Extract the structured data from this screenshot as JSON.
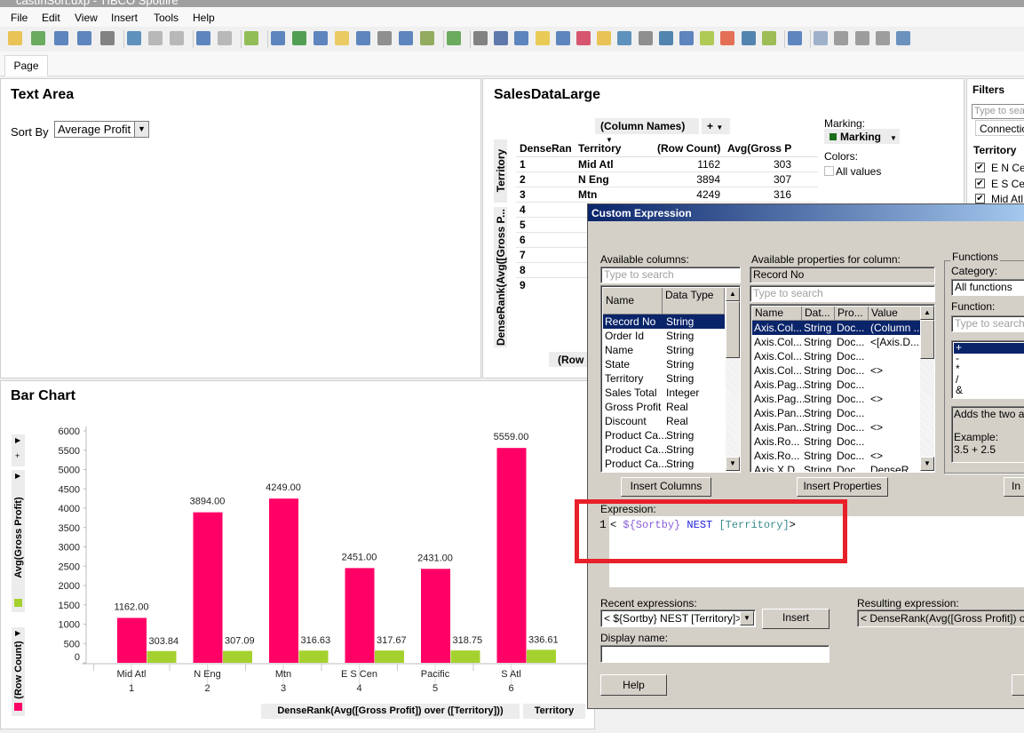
{
  "window": {
    "title": "castInSort.dxp - TIBCO Spotfire"
  },
  "menu": [
    "File",
    "Edit",
    "View",
    "Insert",
    "Tools",
    "Help"
  ],
  "toolbar": {
    "icons": [
      "open-folder-icon",
      "add-data-table-icon",
      "reload-icon",
      "save-icon",
      "print-icon",
      "export-icon",
      "copy-icon",
      "paste-icon",
      "undo-icon",
      "redo-icon",
      "reset-icon",
      "filter-icon",
      "details-on-demand-icon",
      "visualization-properties-icon",
      "tags-icon",
      "bookmark-icon",
      "collaboration-icon",
      "lists-icon",
      "line-similarity-icon",
      "new-page-icon",
      "table-icon",
      "cross-table-icon",
      "graphical-table-icon",
      "bar-chart-icon",
      "line-chart-icon",
      "combination-chart-icon",
      "pie-chart-icon",
      "scatter-plot-icon",
      "3d-scatter-icon",
      "map-chart-icon",
      "treemap-icon",
      "heat-map-icon",
      "parallel-coordinates-icon",
      "summary-table-icon",
      "box-plot-icon",
      "text-area-icon",
      "settings-gear-icon",
      "layout-grid-icon",
      "layout-columns-icon",
      "layout-rows-icon",
      "maximize-icon"
    ]
  },
  "tabs": [
    {
      "label": "Page",
      "active": true
    }
  ],
  "text_area": {
    "title": "Text Area",
    "sort_label": "Sort By",
    "sort_value": "Average Profit"
  },
  "table": {
    "title": "SalesDataLarge",
    "column_names_label": "(Column Names)",
    "plus_label": "+",
    "axis_territory": "Territory",
    "axis_dense": "DenseRank(Avg([Gross P...",
    "row_count_axis": "(Row C",
    "headers": [
      "DenseRank...",
      "Territory",
      "(Row Count)",
      "Avg(Gross P"
    ],
    "rows": [
      [
        "1",
        "Mid Atl",
        "1162",
        "303"
      ],
      [
        "2",
        "N Eng",
        "3894",
        "307"
      ],
      [
        "3",
        "Mtn",
        "4249",
        "316"
      ],
      [
        "4",
        "",
        "",
        ""
      ],
      [
        "5",
        "",
        "",
        ""
      ],
      [
        "6",
        "",
        "",
        ""
      ],
      [
        "7",
        "",
        "",
        ""
      ],
      [
        "8",
        "",
        "",
        ""
      ],
      [
        "9",
        "",
        "",
        ""
      ]
    ],
    "marking_label": "Marking:",
    "marking_value": "Marking",
    "marking_color": "#1a6e1a",
    "colors_label": "Colors:",
    "all_values_label": "All values"
  },
  "filters": {
    "title": "Filters",
    "search_placeholder": "Type to search",
    "connection": "Connection",
    "group": "Territory",
    "items": [
      {
        "label": "E N Cen",
        "checked": true
      },
      {
        "label": "E S Cen",
        "checked": true
      },
      {
        "label": "Mid Atl",
        "checked": true
      }
    ]
  },
  "bar_chart": {
    "title": "Bar Chart",
    "legend_row_count": "(Row Count)",
    "legend_avg": "Avg(Gross Profit)",
    "x_axis_title": "DenseRank(Avg([Gross Profit]) over ([Territory]))",
    "x_axis_title2": "Territory"
  },
  "chart_data": {
    "type": "bar",
    "title": "Bar Chart",
    "categories": [
      "Mid Atl",
      "N Eng",
      "Mtn",
      "E S Cen",
      "Pacific",
      "S Atl"
    ],
    "category_ranks": [
      "1",
      "2",
      "3",
      "4",
      "5",
      "6"
    ],
    "series": [
      {
        "name": "(Row Count)",
        "color": "#ff0066",
        "values": [
          1162,
          3894,
          4249,
          2451,
          2431,
          5559
        ],
        "labels": [
          "1162.00",
          "3894.00",
          "4249.00",
          "2451.00",
          "2431.00",
          "5559.00"
        ]
      },
      {
        "name": "Avg(Gross Profit)",
        "color": "#a5d12f",
        "values": [
          303.84,
          307.09,
          316.63,
          317.67,
          318.75,
          336.61
        ],
        "labels": [
          "303.84",
          "307.09",
          "316.63",
          "317.67",
          "318.75",
          "336.61"
        ]
      }
    ],
    "yticks": [
      "0",
      "500",
      "1000",
      "1500",
      "2000",
      "2500",
      "3000",
      "3500",
      "4000",
      "4500",
      "5000",
      "5500",
      "6000"
    ],
    "ylim": [
      0,
      6000
    ],
    "xlabel": "DenseRank(Avg([Gross Profit]) over ([Territory]))",
    "ylabel": "Avg(Gross Profit) / (Row Count)",
    "grid": false
  },
  "dialog": {
    "title": "Custom Expression",
    "available_columns_label": "Available columns:",
    "search_placeholder": "Type to search",
    "columns_headers": [
      "Name",
      "Data Type"
    ],
    "columns": [
      [
        "Record No",
        "String"
      ],
      [
        "Order Id",
        "String"
      ],
      [
        "Name",
        "String"
      ],
      [
        "State",
        "String"
      ],
      [
        "Territory",
        "String"
      ],
      [
        "Sales Total",
        "Integer"
      ],
      [
        "Gross Profit",
        "Real"
      ],
      [
        "Discount",
        "Real"
      ],
      [
        "Product Ca...",
        "String"
      ],
      [
        "Product Ca...",
        "String"
      ],
      [
        "Product Ca...",
        "String"
      ]
    ],
    "properties_label": "Available properties for column:",
    "selected_column": "Record No",
    "properties_headers": [
      "Name",
      "Dat...",
      "Pro...",
      "Value"
    ],
    "properties": [
      [
        "Axis.Col...",
        "String",
        "Doc...",
        "(Column ..."
      ],
      [
        "Axis.Col...",
        "String",
        "Doc...",
        "<[Axis.D..."
      ],
      [
        "Axis.Col...",
        "String",
        "Doc...",
        ""
      ],
      [
        "Axis.Col...",
        "String",
        "Doc...",
        "<>"
      ],
      [
        "Axis.Pag...",
        "String",
        "Doc...",
        ""
      ],
      [
        "Axis.Pag...",
        "String",
        "Doc...",
        "<>"
      ],
      [
        "Axis.Pan...",
        "String",
        "Doc...",
        ""
      ],
      [
        "Axis.Pan...",
        "String",
        "Doc...",
        "<>"
      ],
      [
        "Axis.Ro...",
        "String",
        "Doc...",
        ""
      ],
      [
        "Axis.Ro...",
        "String",
        "Doc...",
        "<>"
      ],
      [
        "Axis.X.D...",
        "String",
        "Doc...",
        "DenseR..."
      ]
    ],
    "functions_label": "Functions",
    "category_label": "Category:",
    "category_value": "All functions",
    "function_label": "Function:",
    "functions": [
      "+",
      "-",
      "*",
      "/",
      "&"
    ],
    "function_desc": "Adds the two arg",
    "function_example_label": "Example:",
    "function_example": "3.5 + 2.5",
    "insert_columns": "Insert Columns",
    "insert_properties": "Insert Properties",
    "insert_function": "In",
    "expression_label": "Expression:",
    "line_number": "1",
    "expr_tokens": [
      {
        "t": "< ",
        "c": "#000000"
      },
      {
        "t": "${Sortby}",
        "c": "#8a5cd8"
      },
      {
        "t": " NEST ",
        "c": "#2020e0"
      },
      {
        "t": "[Territory]",
        "c": "#3a8a8a"
      },
      {
        "t": ">",
        "c": "#000000"
      }
    ],
    "recent_label": "Recent expressions:",
    "recent_value": "< ${Sortby} NEST [Territory]>",
    "insert_label": "Insert",
    "display_name_label": "Display name:",
    "display_name_value": "",
    "resulting_label": "Resulting expression:",
    "resulting_value": "< DenseRank(Avg([Gross Profit]) over ([",
    "help_label": "Help",
    "highlight_color": "#e8202a"
  }
}
